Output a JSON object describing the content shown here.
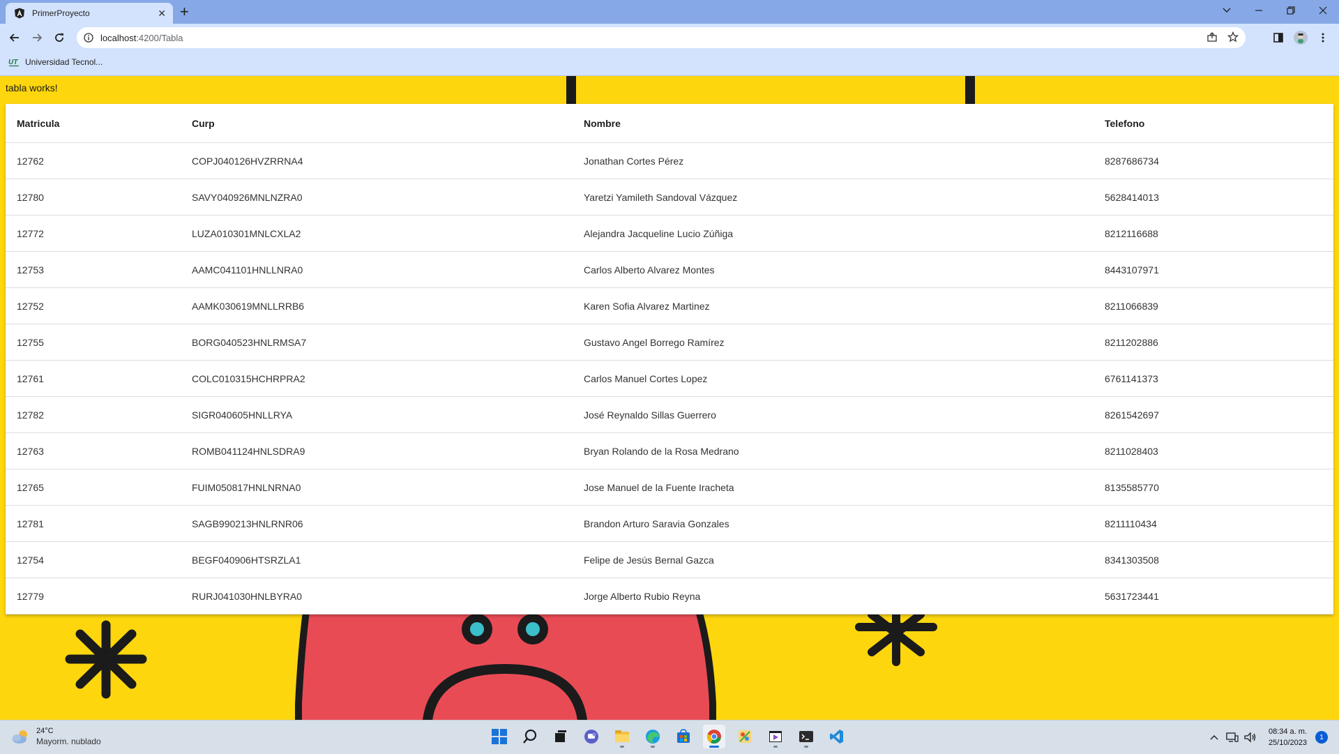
{
  "browser": {
    "tab_title": "PrimerProyecto",
    "new_tab": "+",
    "url_host": "localhost",
    "url_path": ":4200/Tabla",
    "bookmark_label": "Universidad Tecnol..."
  },
  "page": {
    "heading": "tabla works!"
  },
  "table": {
    "headers": [
      "Matricula",
      "Curp",
      "Nombre",
      "Telefono"
    ],
    "rows": [
      [
        "12762",
        "COPJ040126HVZRRNA4",
        "Jonathan Cortes Pérez",
        "8287686734"
      ],
      [
        "12780",
        "SAVY040926MNLNZRA0",
        "Yaretzi Yamileth Sandoval Vázquez",
        "5628414013"
      ],
      [
        "12772",
        "LUZA010301MNLCXLA2",
        "Alejandra Jacqueline Lucio Zúñiga",
        "8212116688"
      ],
      [
        "12753",
        "AAMC041101HNLLNRA0",
        "Carlos Alberto Alvarez Montes",
        "8443107971"
      ],
      [
        "12752",
        "AAMK030619MNLLRRB6",
        "Karen Sofia Alvarez Martinez",
        "8211066839"
      ],
      [
        "12755",
        "BORG040523HNLRMSA7",
        "Gustavo Angel Borrego Ramírez",
        "8211202886"
      ],
      [
        "12761",
        "COLC010315HCHRPRA2",
        "Carlos Manuel Cortes Lopez",
        "6761141373"
      ],
      [
        "12782",
        "SIGR040605HNLLRYA",
        "José Reynaldo Sillas Guerrero",
        "8261542697"
      ],
      [
        "12763",
        "ROMB041124HNLSDRA9",
        "Bryan Rolando de la Rosa Medrano",
        "8211028403"
      ],
      [
        "12765",
        "FUIM050817HNLNRNA0",
        "Jose Manuel de la Fuente Iracheta",
        "8135585770"
      ],
      [
        "12781",
        "SAGB990213HNLRNR06",
        "Brandon Arturo Saravia Gonzales",
        "8211110434"
      ],
      [
        "12754",
        "BEGF040906HTSRZLA1",
        "Felipe de Jesús Bernal Gazca",
        "8341303508"
      ],
      [
        "12779",
        "RURJ041030HNLBYRA0",
        "Jorge Alberto Rubio Reyna",
        "5631723441"
      ]
    ]
  },
  "taskbar": {
    "weather_temp": "24°C",
    "weather_condition": "Mayorm. nublado",
    "time": "08:34 a. m.",
    "date": "25/10/2023",
    "notification_count": "1",
    "apps": [
      "windows-start-icon",
      "search-icon",
      "task-view-icon",
      "teams-chat-icon",
      "file-explorer-icon",
      "edge-icon",
      "microsoft-store-icon",
      "chrome-icon",
      "paint-app-icon",
      "visual-studio-icon",
      "terminal-icon",
      "vscode-icon"
    ]
  },
  "colors": {
    "page_background": "#fdd60d",
    "tab_strip": "#86a8e7",
    "toolbar": "#d3e3fd",
    "character": "#e94b55",
    "eyes": "#3bbfcb"
  }
}
